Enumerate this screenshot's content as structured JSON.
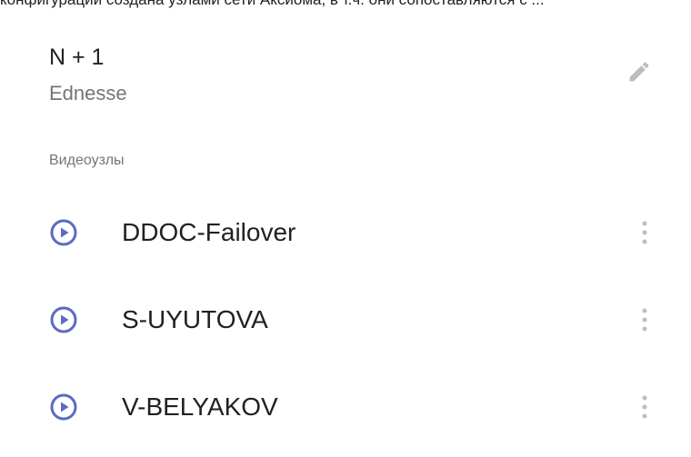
{
  "top_cutoff_text": "конфигурации создана узлами сети Аксиома, в т.ч. они сопоставляются с ...",
  "group": {
    "title": "N + 1",
    "subtitle": "Ednesse",
    "edit_icon": "pencil-icon"
  },
  "section": {
    "label": "Видеоузлы"
  },
  "nodes": [
    {
      "label": "DDOC-Failover",
      "icon": "play-circle-icon",
      "menu_icon": "more-vert-icon"
    },
    {
      "label": "S-UYUTOVA",
      "icon": "play-circle-icon",
      "menu_icon": "more-vert-icon"
    },
    {
      "label": "V-BELYAKOV",
      "icon": "play-circle-icon",
      "menu_icon": "more-vert-icon"
    }
  ],
  "colors": {
    "accent": "#5c6bc0",
    "icon_gray": "#9e9e9e",
    "text_primary": "#212121",
    "text_secondary": "#757575"
  }
}
